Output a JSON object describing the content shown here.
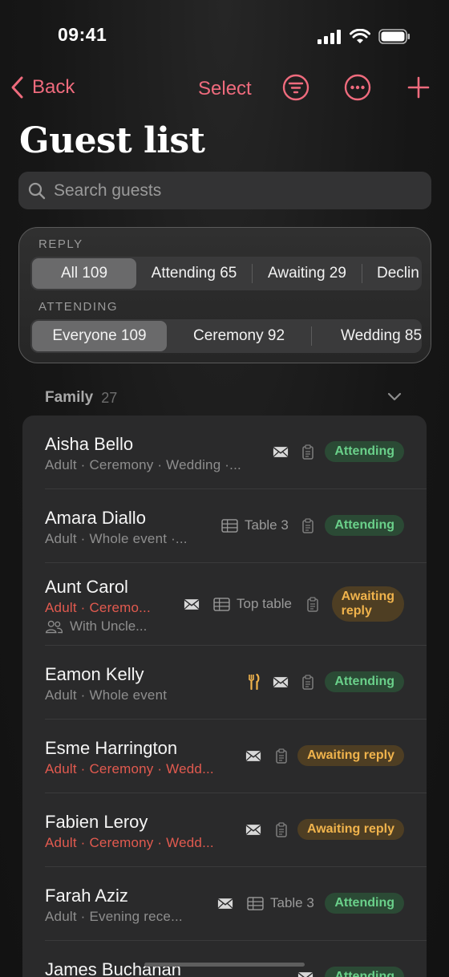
{
  "status": {
    "time": "09:41"
  },
  "nav": {
    "back_label": "Back",
    "select_label": "Select"
  },
  "page": {
    "title": "Guest list"
  },
  "search": {
    "placeholder": "Search guests"
  },
  "filters": {
    "reply_label": "REPLY",
    "reply_options": [
      "All 109",
      "Attending 65",
      "Awaiting 29",
      "Declin"
    ],
    "attending_label": "ATTENDING",
    "attending_options": [
      "Everyone 109",
      "Ceremony 92",
      "Wedding 85"
    ]
  },
  "section": {
    "title": "Family",
    "count": "27"
  },
  "guests": [
    {
      "name": "Aisha Bello",
      "details": "Adult · Ceremony · Wedding ·...",
      "status": "Attending"
    },
    {
      "name": "Amara Diallo",
      "details": "Adult · Whole event ·...",
      "table": "Table 3",
      "status": "Attending"
    },
    {
      "name": "Aunt Carol",
      "details": "Adult · Ceremo...",
      "with": "With Uncle...",
      "table": "Top table",
      "status_line1": "Awaiting",
      "status_line2": "reply"
    },
    {
      "name": "Eamon Kelly",
      "details": "Adult · Whole event",
      "status": "Attending"
    },
    {
      "name": "Esme Harrington",
      "details": "Adult · Ceremony · Wedd...",
      "status": "Awaiting reply"
    },
    {
      "name": "Fabien Leroy",
      "details": "Adult · Ceremony · Wedd...",
      "status": "Awaiting reply"
    },
    {
      "name": "Farah Aziz",
      "details": "Adult · Evening rece...",
      "table": "Table 3",
      "status": "Attending"
    },
    {
      "name": "James Buchanan",
      "status": "Attending"
    }
  ],
  "colors": {
    "accent": "#ef6b7d",
    "attending_bg": "#2b4a35",
    "attending_text": "#6ad08a",
    "awaiting_bg": "#4e3e23",
    "awaiting_text": "#f0b34c",
    "warning_text": "#e25a4f"
  },
  "icons": [
    "signal-icon",
    "wifi-icon",
    "battery-icon",
    "chevron-left-icon",
    "filter-icon",
    "more-icon",
    "plus-icon",
    "search-icon",
    "chevron-down-icon",
    "envelope-icon",
    "note-icon",
    "table-icon",
    "people-icon",
    "cutlery-icon"
  ]
}
